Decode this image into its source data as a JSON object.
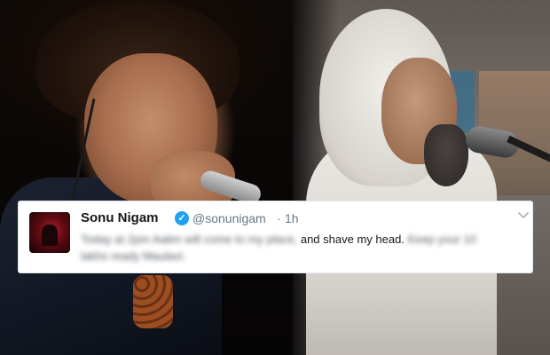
{
  "tweet": {
    "display_name": "Sonu Nigam",
    "handle": "@sonunigam",
    "separator": "·",
    "timestamp": "1h",
    "verified_mark": "✓",
    "text_line1_blurred": "Today at 2pm Aalim will come to my place,",
    "text_line1_clear": "and shave my head.",
    "text_line1_blurred_tail": "Keep your 10",
    "text_line2_blurred": "lakhs ready Maulavi."
  },
  "icons": {
    "verified": "verified-badge-icon",
    "menu": "chevron-down-icon"
  },
  "colors": {
    "verified": "#1da1f2",
    "muted": "#657786",
    "text": "#14171a"
  }
}
